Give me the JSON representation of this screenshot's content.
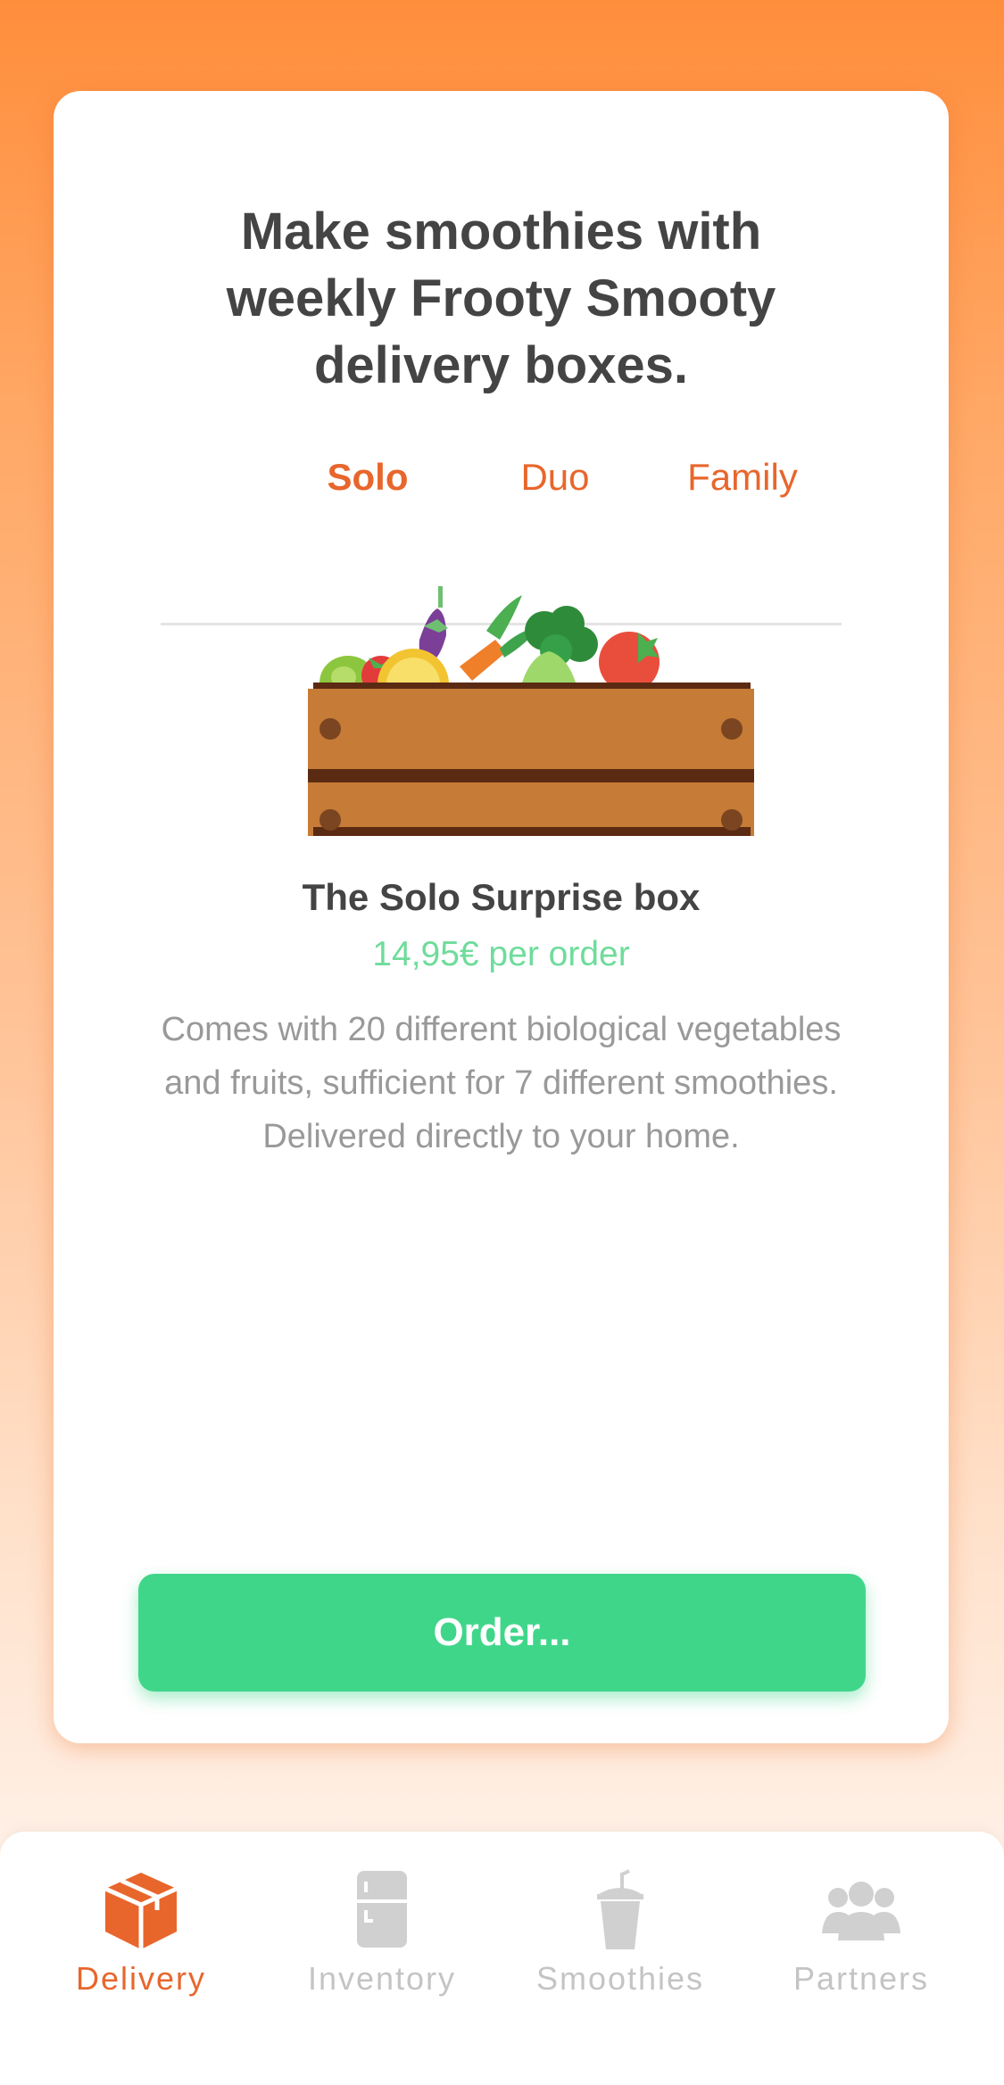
{
  "card": {
    "headline": "Make smoothies with\nweekly Frooty Smooty\ndelivery boxes.",
    "tabs": [
      {
        "label": "Solo",
        "active": true
      },
      {
        "label": "Duo",
        "active": false
      },
      {
        "label": "Family",
        "active": false
      }
    ],
    "box": {
      "illustration": "fruit-vegetable-crate",
      "title": "The Solo Surprise box",
      "price": "14,95€ per order",
      "description": "Comes with 20 different biological vegetables and fruits, sufficient for 7 different smoothies.  Delivered directly to your home."
    },
    "order_button": "Order..."
  },
  "tab_bar": {
    "items": [
      {
        "label": "Delivery",
        "icon": "box-icon",
        "active": true
      },
      {
        "label": "Inventory",
        "icon": "fridge-icon",
        "active": false
      },
      {
        "label": "Smoothies",
        "icon": "smoothie-cup-icon",
        "active": false
      },
      {
        "label": "Partners",
        "icon": "people-icon",
        "active": false
      }
    ]
  },
  "colors": {
    "accent": "#E8662C",
    "order_button": "#40D68A",
    "price": "#6FDC9B",
    "heading_text": "#444444",
    "body_text": "#999999",
    "inactive_icon": "#D0D0D0"
  }
}
